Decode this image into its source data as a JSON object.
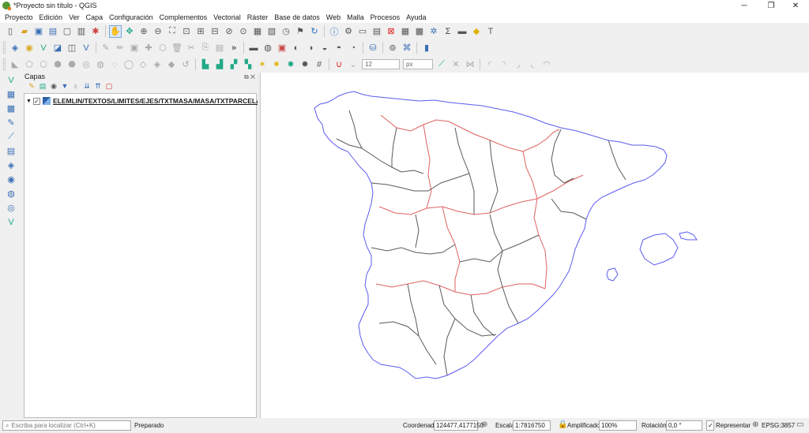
{
  "window": {
    "title": "*Proyecto sin título - QGIS",
    "minimize": "─",
    "maximize": "❐",
    "close": "✕"
  },
  "menu": [
    "Proyecto",
    "Edición",
    "Ver",
    "Capa",
    "Configuración",
    "Complementos",
    "Vectorial",
    "Ráster",
    "Base de datos",
    "Web",
    "Malla",
    "Procesos",
    "Ayuda"
  ],
  "toolbar": {
    "more_label": "»",
    "font_size_value": "12",
    "font_unit": "px"
  },
  "layers_panel": {
    "title": "Capas",
    "layer_name": "ELEMLIN/TEXTOS/LIMITES/EJES/TXTMASA/MASA/TXTPARCELA...",
    "layer_checked": "✓",
    "panel_buttons": "⧉ ✕"
  },
  "map": {
    "colors": {
      "coast": "#5b5bef",
      "admin_red": "#e06262",
      "admin_grey": "#5a5a5a"
    }
  },
  "status": {
    "locator_placeholder": "Escriba para localizar (Ctrl+K)",
    "message": "Preparado",
    "coordinate_label": "Coordenada",
    "coordinate_value": "124477,4177150",
    "scale_label": "Escala",
    "scale_value": "1:7816750",
    "magnifier_label": "Amplificador",
    "magnifier_value": "100%",
    "rotation_label": "Rotación",
    "rotation_value": "0,0 °",
    "render_label": "Representar",
    "render_checked": "✓",
    "crs": "EPSG:3857"
  }
}
